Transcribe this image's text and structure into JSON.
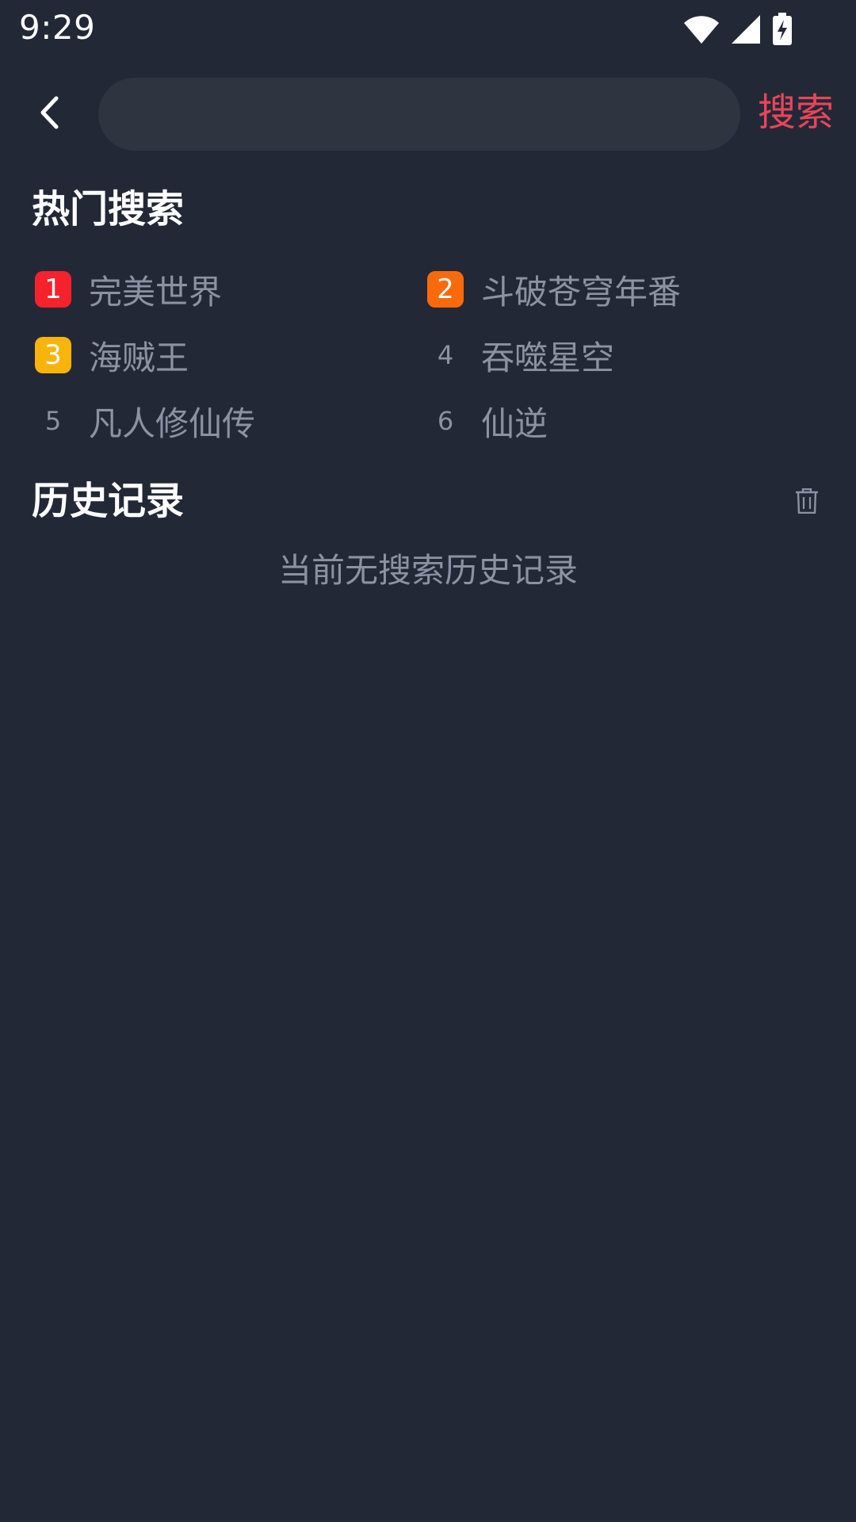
{
  "status_bar": {
    "time": "9:29",
    "icons": [
      "wifi-icon",
      "cellular-signal-icon",
      "battery-charging-icon"
    ]
  },
  "topbar": {
    "back_icon": "chevron-left-icon",
    "search_value": "",
    "search_placeholder": "",
    "search_label": "搜索"
  },
  "hot": {
    "title": "热门搜索",
    "items": [
      {
        "rank": "1",
        "label": "完美世界"
      },
      {
        "rank": "2",
        "label": "斗破苍穹年番"
      },
      {
        "rank": "3",
        "label": "海贼王"
      },
      {
        "rank": "4",
        "label": "吞噬星空"
      },
      {
        "rank": "5",
        "label": "凡人修仙传"
      },
      {
        "rank": "6",
        "label": "仙逆"
      }
    ]
  },
  "history": {
    "title": "历史记录",
    "clear_icon": "trash-icon",
    "empty_text": "当前无搜索历史记录"
  },
  "colors": {
    "background": "#232836",
    "search_box": "#2f3441",
    "accent": "#e8455a",
    "rank1": "#f5222d",
    "rank2": "#fa6a0a",
    "rank3": "#f9b40c",
    "muted_text": "#8d92a3"
  }
}
